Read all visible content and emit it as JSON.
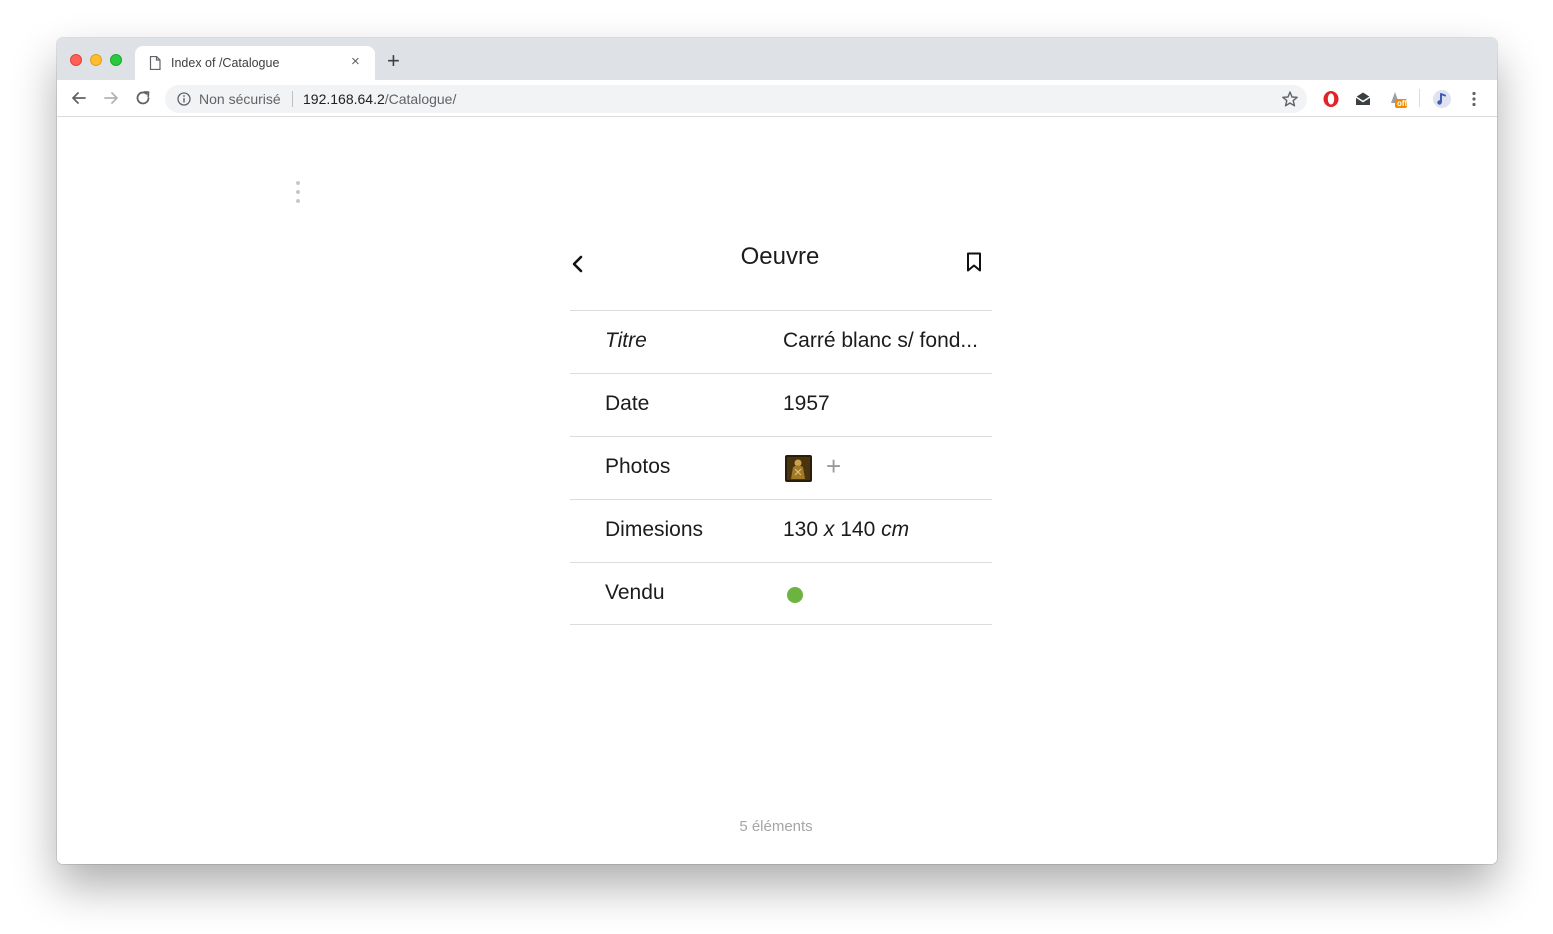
{
  "browser": {
    "tab": {
      "title": "Index of /Catalogue",
      "close_glyph": "×"
    },
    "new_tab_glyph": "+",
    "omnibox": {
      "security_label": "Non sécurisé",
      "url_host": "192.168.64.2",
      "url_path": "/Catalogue/"
    },
    "extensions": {
      "badge_text": "off"
    }
  },
  "page": {
    "header": {
      "title": "Oeuvre"
    },
    "rows": [
      {
        "label": "Titre",
        "value": "Carré blanc s/ fond..."
      },
      {
        "label": "Date",
        "value": "1957"
      },
      {
        "label": "Photos",
        "add_glyph": "+"
      },
      {
        "label": "Dimesions",
        "value_num1": "130",
        "value_x": "x",
        "value_num2": "140",
        "value_unit": "cm"
      },
      {
        "label": "Vendu",
        "status": true,
        "status_color": "#6db33f"
      }
    ],
    "footer": "5 éléments"
  },
  "colors": {
    "accent_green": "#6db33f",
    "tab_strip": "#dee1e6",
    "omnibox_bg": "#f1f3f4"
  }
}
